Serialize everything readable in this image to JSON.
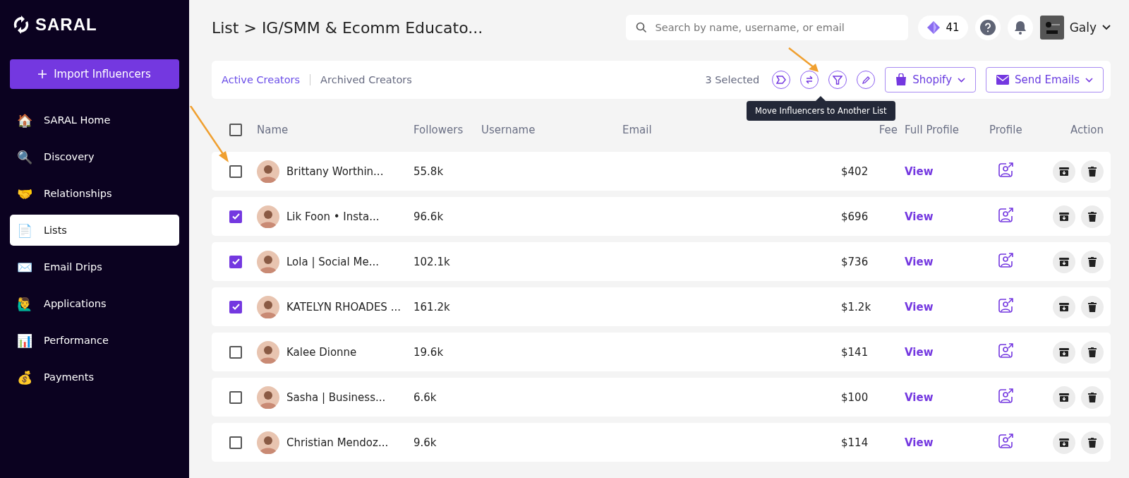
{
  "sidebar": {
    "logo": "SARAL",
    "import_button": "Import Influencers",
    "items": [
      {
        "label": "SARAL Home",
        "emoji": "🏠",
        "selected": false
      },
      {
        "label": "Discovery",
        "emoji": "🔍",
        "selected": false
      },
      {
        "label": "Relationships",
        "emoji": "🤝",
        "selected": false
      },
      {
        "label": "Lists",
        "emoji": "📄",
        "selected": true
      },
      {
        "label": "Email Drips",
        "emoji": "✉️",
        "selected": false
      },
      {
        "label": "Applications",
        "emoji": "🙋‍♂️",
        "selected": false
      },
      {
        "label": "Performance",
        "emoji": "📊",
        "selected": false
      },
      {
        "label": "Payments",
        "emoji": "💰",
        "selected": false
      }
    ]
  },
  "header": {
    "breadcrumb": "List > IG/SMM & Ecomm Educato...",
    "search": {
      "placeholder": "Search by name, username, or email"
    },
    "credits": "41",
    "user": "Galy"
  },
  "toolbar": {
    "tabs": [
      {
        "label": "Active Creators",
        "selected": true
      },
      {
        "label": "Archived Creators",
        "selected": false
      }
    ],
    "selected_count": "3 Selected",
    "shopify_button": "Shopify",
    "send_button": "Send Emails",
    "tooltip": "Move Influencers to Another List"
  },
  "table": {
    "select_all_checked": false,
    "columns": [
      "Name",
      "Followers",
      "Username",
      "Email",
      "Fee",
      "Full Profile",
      "Profile",
      "Action"
    ],
    "rows": [
      {
        "name": "Brittany Worthin...",
        "followers": "55.8k",
        "fee": "$402",
        "link": "View",
        "checked": false
      },
      {
        "name": "Lik Foon • Insta...",
        "followers": "96.6k",
        "fee": "$696",
        "link": "View",
        "checked": true
      },
      {
        "name": "Lola | Social Me...",
        "followers": "102.1k",
        "fee": "$736",
        "link": "View",
        "checked": true
      },
      {
        "name": "KATELYN RHOADES ...",
        "followers": "161.2k",
        "fee": "$1.2k",
        "link": "View",
        "checked": true
      },
      {
        "name": "Kalee Dionne",
        "followers": "19.6k",
        "fee": "$141",
        "link": "View",
        "checked": false
      },
      {
        "name": "Sasha | Business...",
        "followers": "6.6k",
        "fee": "$100",
        "link": "View",
        "checked": false
      },
      {
        "name": "Christian Mendoz...",
        "followers": "9.6k",
        "fee": "$114",
        "link": "View",
        "checked": false
      }
    ]
  }
}
